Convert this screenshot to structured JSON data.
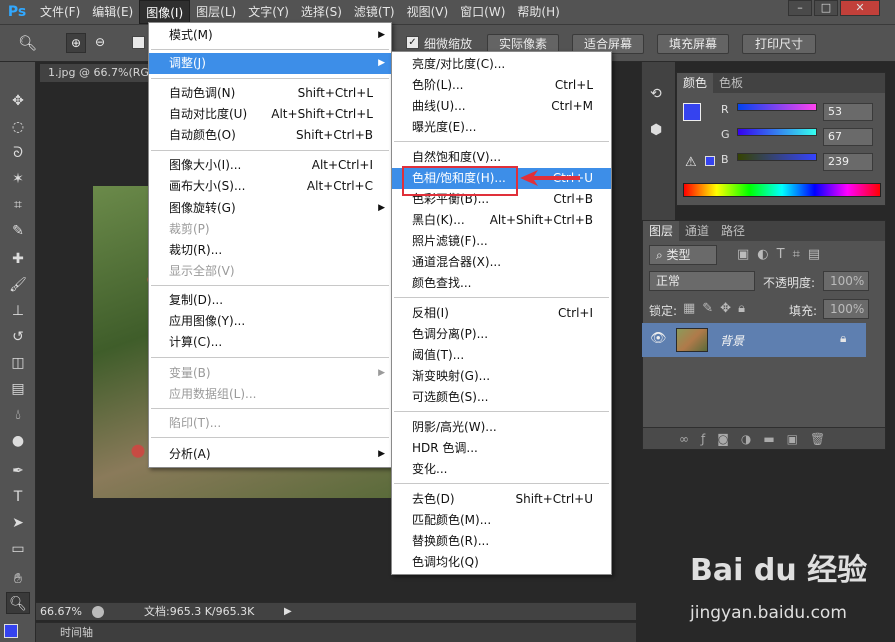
{
  "app": {
    "logo": "Ps"
  },
  "menubar": {
    "items": [
      "文件(F)",
      "编辑(E)",
      "图像(I)",
      "图层(L)",
      "文字(Y)",
      "选择(S)",
      "滤镜(T)",
      "视图(V)",
      "窗口(W)",
      "帮助(H)"
    ],
    "active_index": 2
  },
  "window_controls": {
    "minimize": "–",
    "maximize": "□",
    "close": "✕"
  },
  "options_bar": {
    "zoom_checkbox_label": "细微缩放",
    "buttons": [
      "实际像素",
      "适合屏幕",
      "填充屏幕",
      "打印尺寸"
    ]
  },
  "document": {
    "tab_title": "1.jpg @ 66.7%(RG",
    "zoom": "66.67%",
    "doc_size": "文档:965.3 K/965.3K",
    "timeline": "时间轴"
  },
  "image_menu": {
    "items": [
      {
        "label": "模式(M)",
        "shortcut": "",
        "submenu": true,
        "disabled": false
      },
      {
        "label": "调整(J)",
        "shortcut": "",
        "submenu": true,
        "disabled": false,
        "highlight": true
      },
      {
        "label": "自动色调(N)",
        "shortcut": "Shift+Ctrl+L",
        "disabled": false
      },
      {
        "label": "自动对比度(U)",
        "shortcut": "Alt+Shift+Ctrl+L",
        "disabled": false
      },
      {
        "label": "自动颜色(O)",
        "shortcut": "Shift+Ctrl+B",
        "disabled": false
      },
      {
        "label": "图像大小(I)...",
        "shortcut": "Alt+Ctrl+I",
        "disabled": false
      },
      {
        "label": "画布大小(S)...",
        "shortcut": "Alt+Ctrl+C",
        "disabled": false
      },
      {
        "label": "图像旋转(G)",
        "shortcut": "",
        "submenu": true,
        "disabled": false
      },
      {
        "label": "裁剪(P)",
        "shortcut": "",
        "disabled": true
      },
      {
        "label": "裁切(R)...",
        "shortcut": "",
        "disabled": false
      },
      {
        "label": "显示全部(V)",
        "shortcut": "",
        "disabled": true
      },
      {
        "label": "复制(D)...",
        "shortcut": "",
        "disabled": false
      },
      {
        "label": "应用图像(Y)...",
        "shortcut": "",
        "disabled": false
      },
      {
        "label": "计算(C)...",
        "shortcut": "",
        "disabled": false
      },
      {
        "label": "变量(B)",
        "shortcut": "",
        "submenu": true,
        "disabled": true
      },
      {
        "label": "应用数据组(L)...",
        "shortcut": "",
        "disabled": true
      },
      {
        "label": "陷印(T)...",
        "shortcut": "",
        "disabled": true
      },
      {
        "label": "分析(A)",
        "shortcut": "",
        "submenu": true,
        "disabled": false
      }
    ]
  },
  "adjust_menu": {
    "items": [
      {
        "label": "亮度/对比度(C)...",
        "shortcut": ""
      },
      {
        "label": "色阶(L)...",
        "shortcut": "Ctrl+L"
      },
      {
        "label": "曲线(U)...",
        "shortcut": "Ctrl+M"
      },
      {
        "label": "曝光度(E)...",
        "shortcut": ""
      },
      {
        "label": "自然饱和度(V)...",
        "shortcut": ""
      },
      {
        "label": "色相/饱和度(H)...",
        "shortcut": "Ctrl+U",
        "highlight": true
      },
      {
        "label": "色彩平衡(B)...",
        "shortcut": "Ctrl+B"
      },
      {
        "label": "黑白(K)...",
        "shortcut": "Alt+Shift+Ctrl+B"
      },
      {
        "label": "照片滤镜(F)...",
        "shortcut": ""
      },
      {
        "label": "通道混合器(X)...",
        "shortcut": ""
      },
      {
        "label": "颜色查找...",
        "shortcut": ""
      },
      {
        "label": "反相(I)",
        "shortcut": "Ctrl+I"
      },
      {
        "label": "色调分离(P)...",
        "shortcut": ""
      },
      {
        "label": "阈值(T)...",
        "shortcut": ""
      },
      {
        "label": "渐变映射(G)...",
        "shortcut": ""
      },
      {
        "label": "可选颜色(S)...",
        "shortcut": ""
      },
      {
        "label": "阴影/高光(W)...",
        "shortcut": ""
      },
      {
        "label": "HDR 色调...",
        "shortcut": ""
      },
      {
        "label": "变化...",
        "shortcut": ""
      },
      {
        "label": "去色(D)",
        "shortcut": "Shift+Ctrl+U"
      },
      {
        "label": "匹配颜色(M)...",
        "shortcut": ""
      },
      {
        "label": "替换颜色(R)...",
        "shortcut": ""
      },
      {
        "label": "色调均化(Q)",
        "shortcut": ""
      }
    ]
  },
  "color_panel": {
    "tabs": [
      "颜色",
      "色板"
    ],
    "r_label": "R",
    "g_label": "G",
    "b_label": "B",
    "r_value": "53",
    "g_value": "67",
    "b_value": "239",
    "fg_color": "#3543ef"
  },
  "layers_panel": {
    "tabs": [
      "图层",
      "通道",
      "路径"
    ],
    "filter_label": "类型",
    "blend_mode": "正常",
    "opacity_label": "不透明度:",
    "opacity_value": "100%",
    "lock_label": "锁定:",
    "fill_label": "填充:",
    "fill_value": "100%",
    "layer_name": "背景"
  },
  "watermark": {
    "logo": "Bai du 经验",
    "url": "jingyan.baidu.com"
  }
}
